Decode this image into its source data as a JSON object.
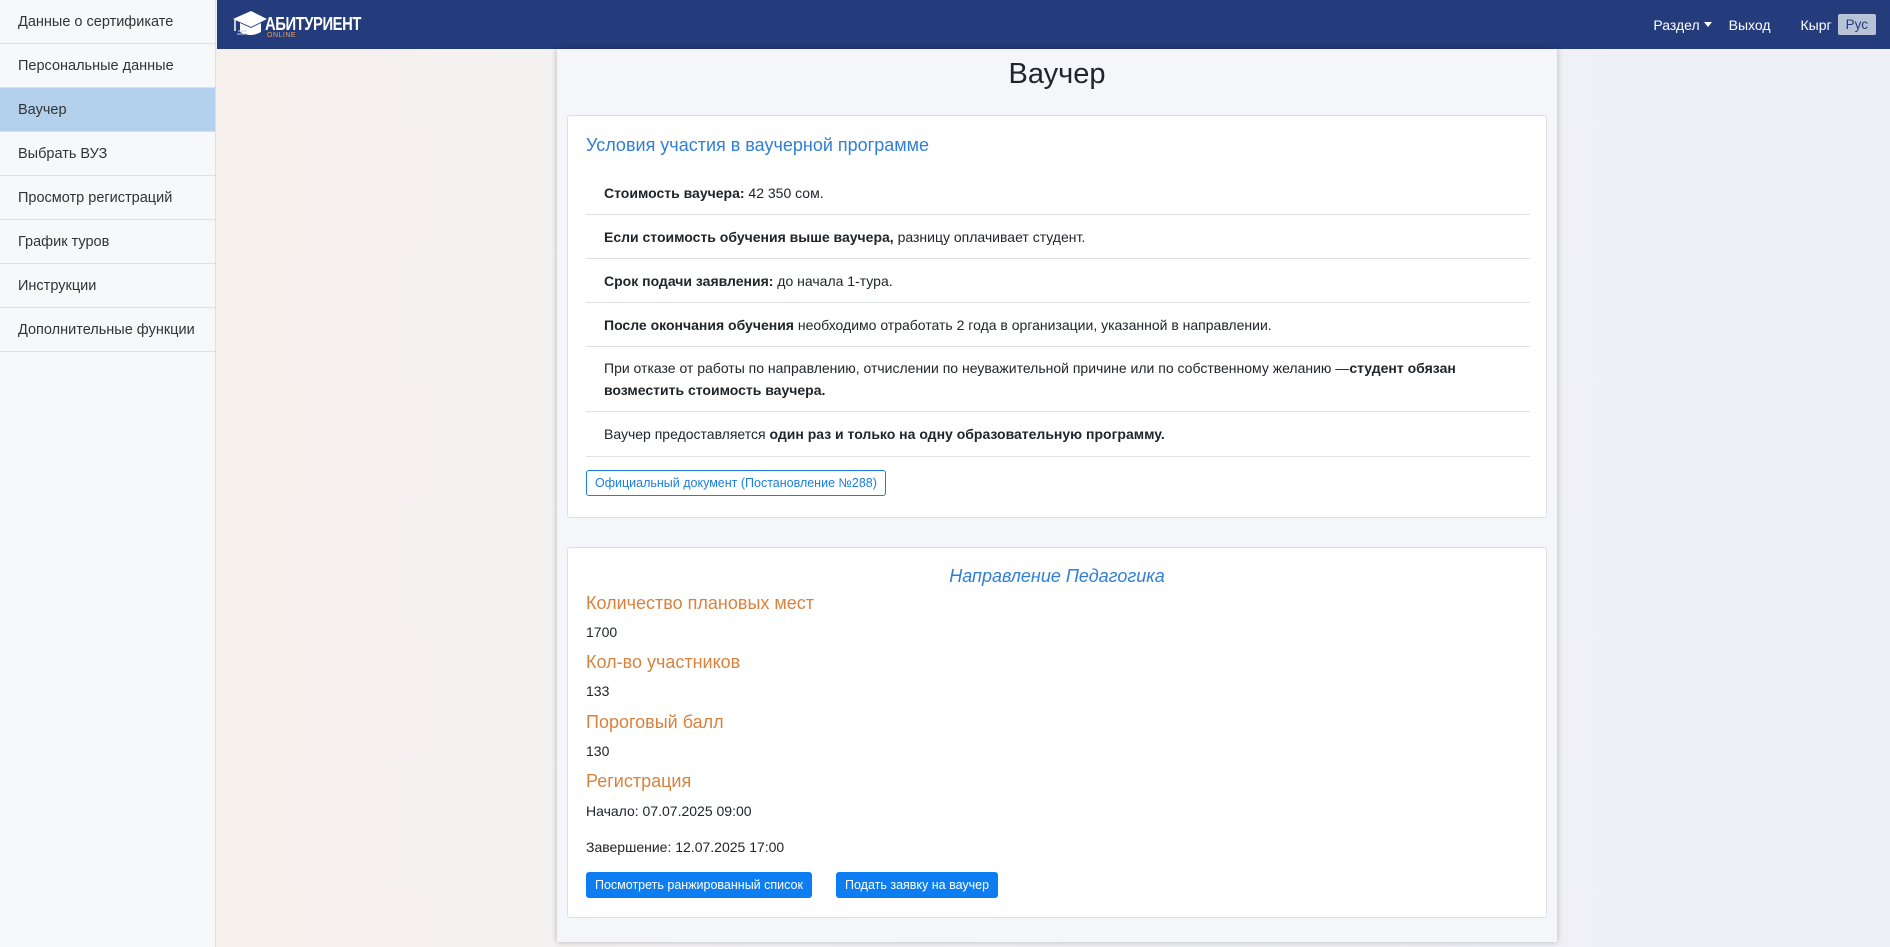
{
  "sidebar": {
    "items": [
      {
        "label": "Данные о сертификате"
      },
      {
        "label": "Персональные данные"
      },
      {
        "label": "Ваучер"
      },
      {
        "label": "Выбрать ВУЗ"
      },
      {
        "label": "Просмотр регистраций"
      },
      {
        "label": "График туров"
      },
      {
        "label": "Инструкции"
      },
      {
        "label": "Дополнительные функции"
      }
    ],
    "active_index": 2
  },
  "header": {
    "logo_text": "АБИТУРИЕНТ",
    "logo_sub": "ONLINE",
    "section_menu": "Раздел",
    "logout": "Выход",
    "lang_kyrg": "Кырг",
    "lang_rus": "Рус",
    "brand_color": "#243c7c"
  },
  "main": {
    "title": "Ваучер",
    "conditions": {
      "title": "Условия участия в ваучерной программе",
      "items": [
        {
          "bold": "Стоимость ваучера:",
          "text": " 42 350 сом."
        },
        {
          "bold": "Если стоимость обучения выше ваучера,",
          "text": " разницу оплачивает студент."
        },
        {
          "bold": "Срок подачи заявления:",
          "text": " до начала 1-тура."
        },
        {
          "bold": "После окончания обучения",
          "text": " необходимо отработать 2 года в организации, указанной в направлении."
        },
        {
          "text": "При отказе от работы по направлению, отчислении по неуважительной причине или по собственному желанию —",
          "bold": "студент обязан возместить стоимость ваучера."
        },
        {
          "text": "Ваучер предоставляется ",
          "bold": "один раз и только на одну образовательную программу."
        }
      ],
      "doc_button": "Официальный документ (Постановление №288)"
    },
    "direction": {
      "title": "Направление Педагогика",
      "planned_places_label": "Количество плановых мест",
      "planned_places": "1700",
      "participants_label": "Кол-во участников",
      "participants": "133",
      "threshold_label": "Пороговый балл",
      "threshold": "130",
      "registration_label": "Регистрация",
      "start": "Начало: 07.07.2025 09:00",
      "end": "Завершение: 12.07.2025 17:00",
      "ranked_list_button": "Посмотреть ранжированный список",
      "apply_button": "Подать заявку на ваучер"
    }
  }
}
